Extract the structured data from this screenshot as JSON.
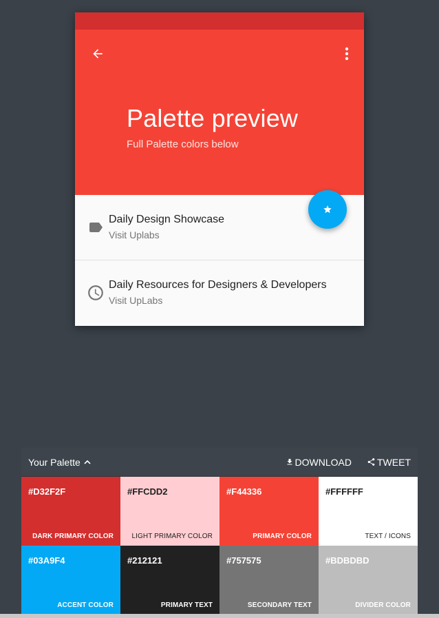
{
  "preview": {
    "title": "Palette preview",
    "subtitle": "Full Palette colors below",
    "back_icon": "arrow-back-icon",
    "more_icon": "more-vert-icon",
    "fab_icon": "star-icon",
    "items": [
      {
        "primary": "Daily Design Showcase",
        "secondary": "Visit Uplabs",
        "icon": "label-icon"
      },
      {
        "primary": "Daily Resources for Designers & Developers",
        "secondary": "Visit UpLabs",
        "icon": "clock-icon"
      }
    ]
  },
  "palette": {
    "title": "Your Palette",
    "download_label": "DOWNLOAD",
    "tweet_label": "TWEET",
    "swatches": [
      {
        "hex": "#D32F2F",
        "role": "DARK PRIMARY COLOR",
        "color": "#d32f2f",
        "text_color": "#ffffff"
      },
      {
        "hex": "#FFCDD2",
        "role": "LIGHT PRIMARY COLOR",
        "color": "#ffcdd2",
        "text_color": "#212121"
      },
      {
        "hex": "#F44336",
        "role": "PRIMARY COLOR",
        "color": "#f44336",
        "text_color": "#ffffff"
      },
      {
        "hex": "#FFFFFF",
        "role": "TEXT / ICONS",
        "color": "#ffffff",
        "text_color": "#212121"
      },
      {
        "hex": "#03A9F4",
        "role": "ACCENT COLOR",
        "color": "#03a9f4",
        "text_color": "#ffffff"
      },
      {
        "hex": "#212121",
        "role": "PRIMARY TEXT",
        "color": "#212121",
        "text_color": "#ffffff"
      },
      {
        "hex": "#757575",
        "role": "SECONDARY TEXT",
        "color": "#757575",
        "text_color": "#ffffff"
      },
      {
        "hex": "#BDBDBD",
        "role": "DIVIDER COLOR",
        "color": "#bdbdbd",
        "text_color": "#ffffff"
      }
    ]
  }
}
